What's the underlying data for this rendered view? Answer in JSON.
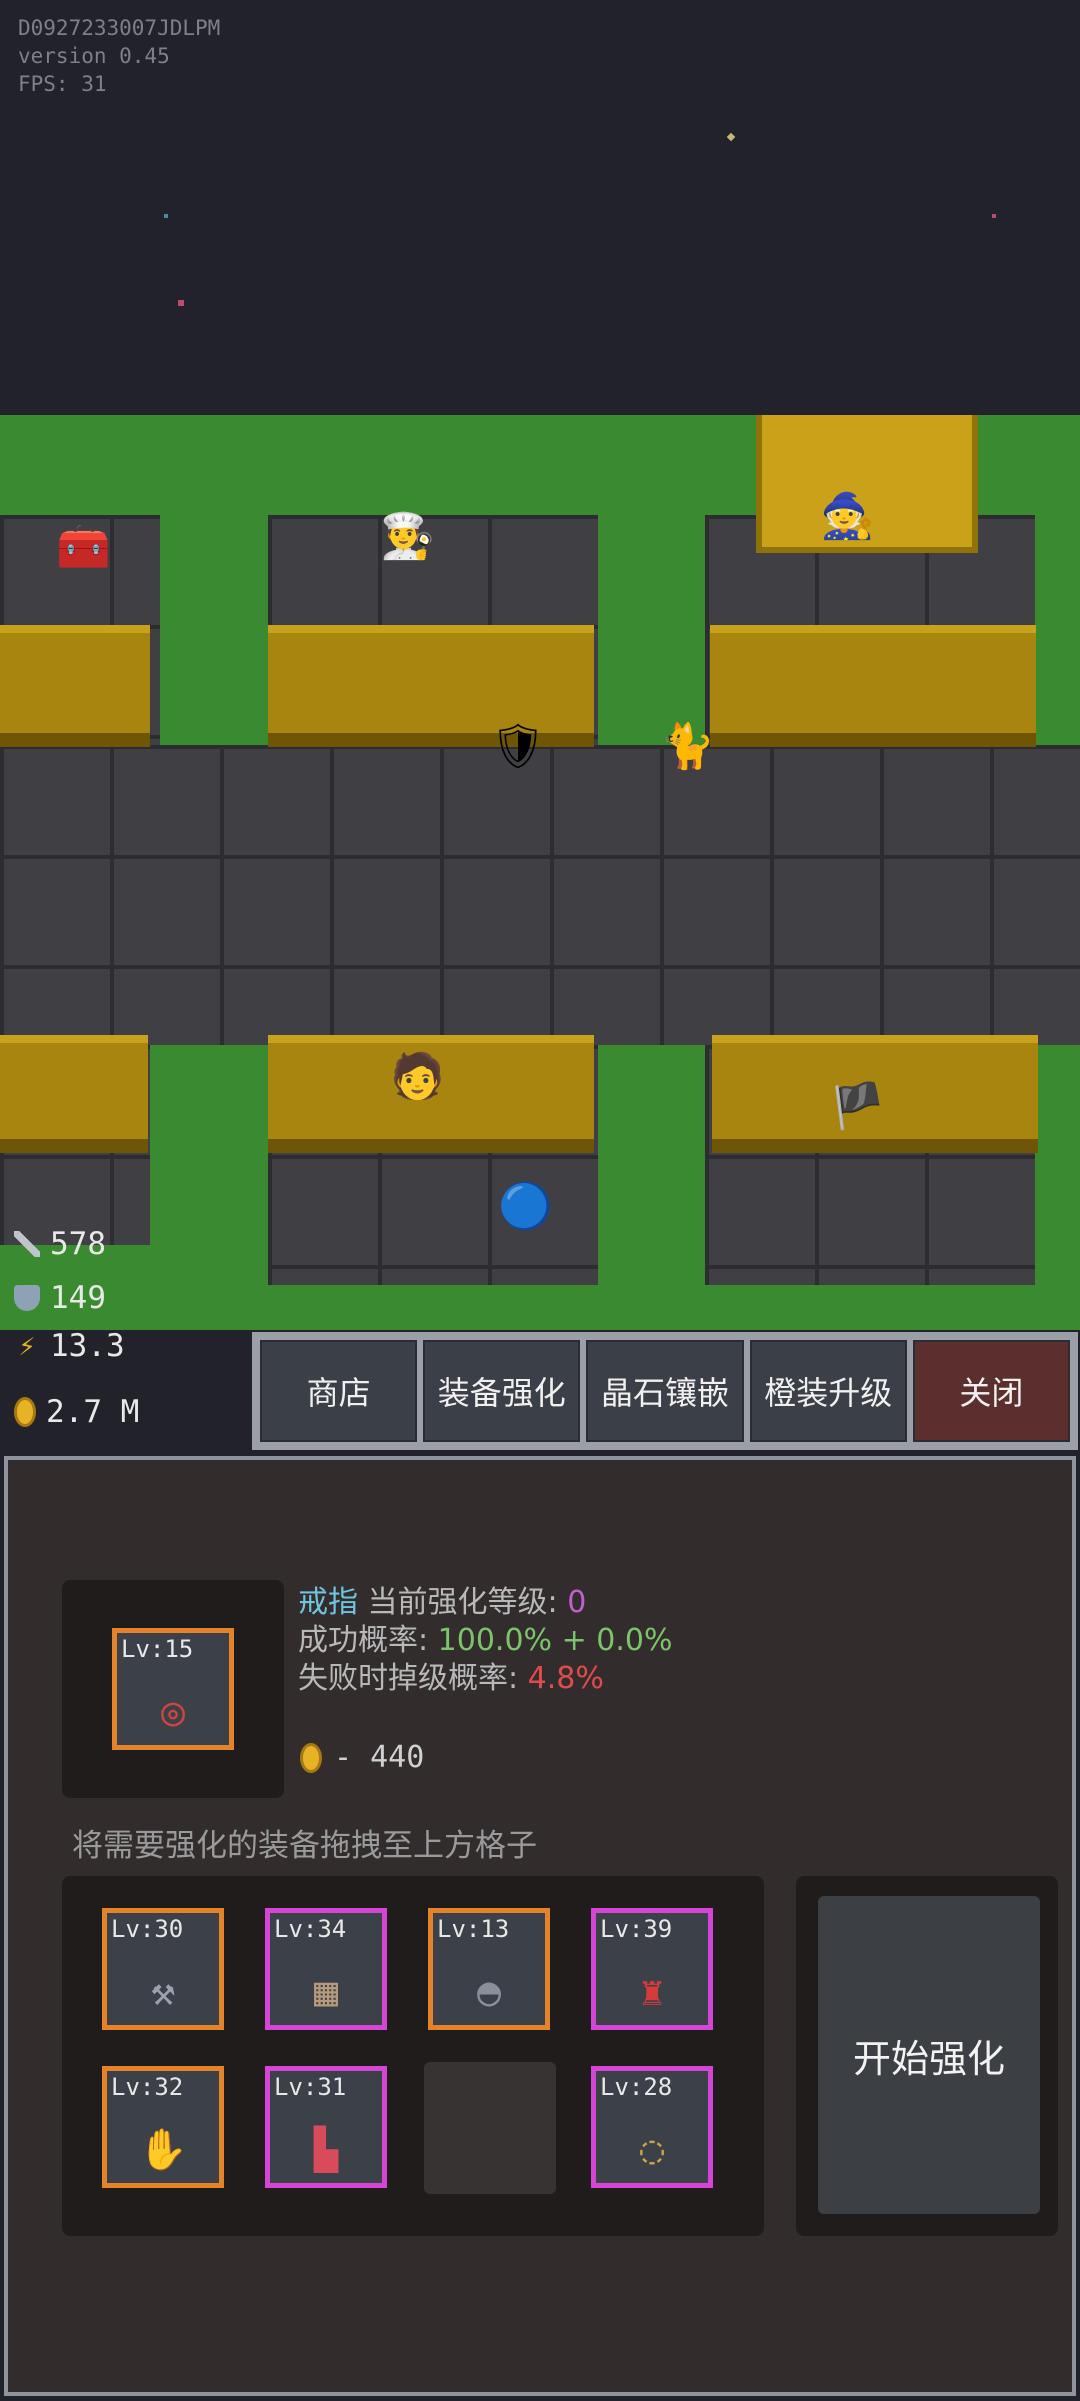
{
  "debug": {
    "device_id": "D0927233007JDLPM",
    "version": "version 0.45",
    "fps": "FPS: 31"
  },
  "hud": {
    "attack": "578",
    "defense": "149",
    "speed": "13.3",
    "gold": "2.7 M"
  },
  "menu": {
    "shop": "商店",
    "enhance": "装备强化",
    "gem_inlay": "晶石镶嵌",
    "set_upgrade": "橙装升级",
    "close": "关闭"
  },
  "enhance_panel": {
    "target_item": {
      "level": "Lv:15",
      "icon": "ring-icon",
      "rarity": "orange"
    },
    "item_name": "戒指",
    "current_level_label": "当前强化等级:",
    "current_level_value": "0",
    "success_label": "成功概率:",
    "success_value": "100.0% + 0.0%",
    "downgrade_label": "失败时掉级概率:",
    "downgrade_value": "4.8%",
    "cost": "- 440",
    "hint": "将需要强化的装备拖拽至上方格子",
    "start_button": "开始强化",
    "inventory": [
      {
        "level": "Lv:30",
        "icon": "axe-icon",
        "rarity": "orange"
      },
      {
        "level": "Lv:34",
        "icon": "chainmail-icon",
        "rarity": "purple"
      },
      {
        "level": "Lv:13",
        "icon": "helmet-icon",
        "rarity": "orange"
      },
      {
        "level": "Lv:39",
        "icon": "armor-icon",
        "rarity": "purple"
      },
      {
        "level": "Lv:32",
        "icon": "gloves-icon",
        "rarity": "orange"
      },
      {
        "level": "Lv:31",
        "icon": "boots-icon",
        "rarity": "purple"
      },
      {
        "level": "",
        "icon": "",
        "rarity": "empty"
      },
      {
        "level": "Lv:28",
        "icon": "necklace-icon",
        "rarity": "purple"
      }
    ]
  },
  "colors": {
    "orange_border": "#e48329",
    "purple_border": "#d545d6",
    "panel_bg": "#322c2c"
  }
}
